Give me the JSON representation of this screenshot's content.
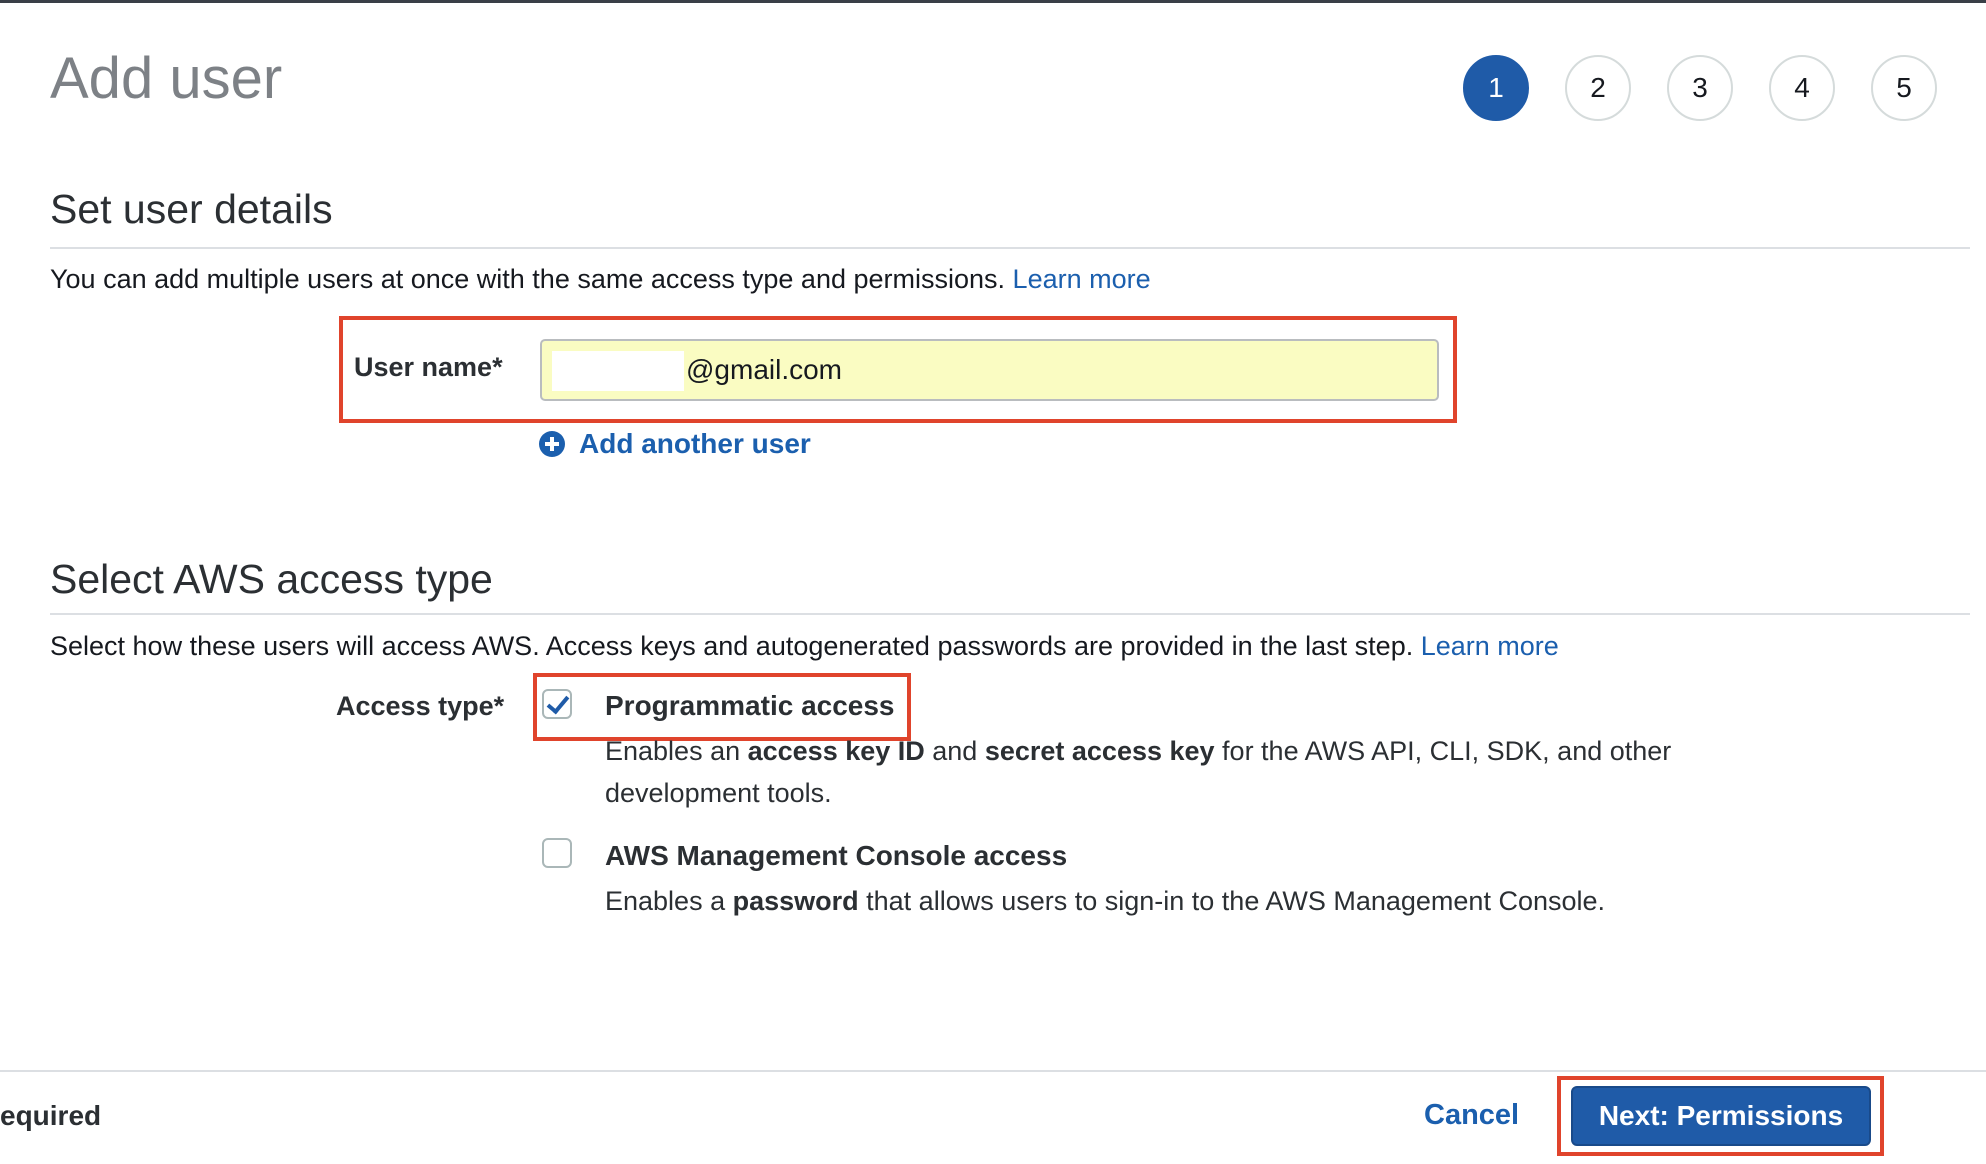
{
  "header": {
    "title": "Add user",
    "steps": [
      "1",
      "2",
      "3",
      "4",
      "5"
    ],
    "active_step": "1"
  },
  "user_details": {
    "section_title": "Set user details",
    "description": "You can add multiple users at once with the same access type and permissions.",
    "learn_more": "Learn more",
    "user_name_label": "User name*",
    "user_name_value": "@gmail.com",
    "add_another_user": "Add another user"
  },
  "access_type": {
    "section_title": "Select AWS access type",
    "description": "Select how these users will access AWS. Access keys and autogenerated passwords are provided in the last step.",
    "learn_more": "Learn more",
    "label": "Access type*",
    "options": [
      {
        "title": "Programmatic access",
        "checked": true,
        "desc_parts": [
          "Enables an ",
          "access key ID",
          " and ",
          "secret access key",
          " for the AWS API, CLI, SDK, and other development tools."
        ]
      },
      {
        "title": "AWS Management Console access",
        "checked": false,
        "desc_parts": [
          "Enables a ",
          "password",
          " that allows users to sign-in to the AWS Management Console."
        ]
      }
    ]
  },
  "footer": {
    "required_text": "equired",
    "cancel_label": "Cancel",
    "next_label": "Next: Permissions"
  },
  "colors": {
    "highlight": "#e0442c",
    "primary": "#1f5ba8",
    "link": "#1b5fae",
    "input_fill": "#fafcc2"
  }
}
